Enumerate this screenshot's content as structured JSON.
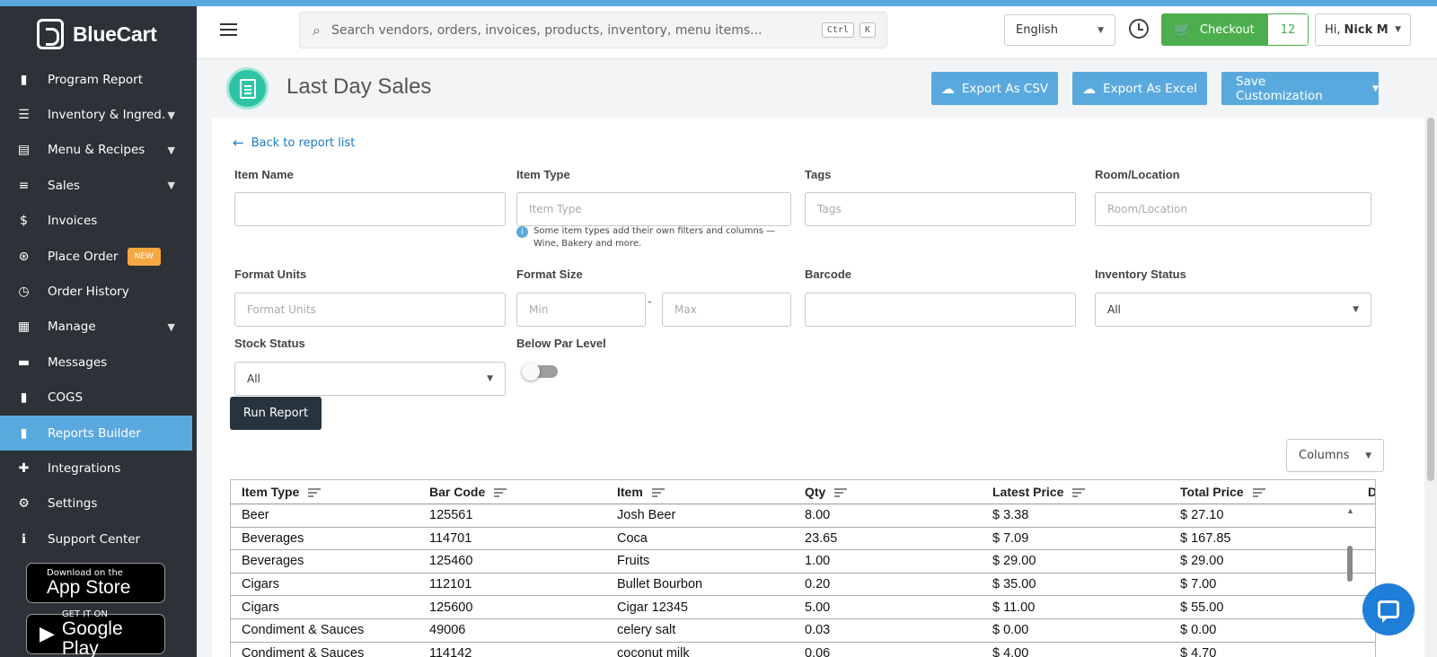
{
  "app": {
    "brand": "BlueCart",
    "accent": "#5aa9de",
    "sidebar_bg": "#2c3238"
  },
  "sidebar": {
    "items": [
      {
        "label": "Program Report",
        "icon": "bar-chart-icon",
        "glyph": "▮",
        "chevron": false
      },
      {
        "label": "Inventory & Ingred.",
        "icon": "list-icon",
        "glyph": "☰",
        "chevron": true
      },
      {
        "label": "Menu & Recipes",
        "icon": "book-icon",
        "glyph": "▤",
        "chevron": true
      },
      {
        "label": "Sales",
        "icon": "stack-icon",
        "glyph": "≡",
        "chevron": true
      },
      {
        "label": "Invoices",
        "icon": "dollar-icon",
        "glyph": "$",
        "chevron": false
      },
      {
        "label": "Place Order",
        "icon": "order-icon",
        "glyph": "⊛",
        "chevron": false,
        "badge": "NEW"
      },
      {
        "label": "Order History",
        "icon": "history-icon",
        "glyph": "◷",
        "chevron": false
      },
      {
        "label": "Manage",
        "icon": "manage-icon",
        "glyph": "▦",
        "chevron": true
      },
      {
        "label": "Messages",
        "icon": "message-icon",
        "glyph": "▬",
        "chevron": false
      },
      {
        "label": "COGS",
        "icon": "cogs-chart-icon",
        "glyph": "▮",
        "chevron": false
      },
      {
        "label": "Reports Builder",
        "icon": "reports-icon",
        "glyph": "▮",
        "chevron": false,
        "active": true
      },
      {
        "label": "Integrations",
        "icon": "puzzle-icon",
        "glyph": "✚",
        "chevron": false
      },
      {
        "label": "Settings",
        "icon": "gear-icon",
        "glyph": "⚙",
        "chevron": false
      },
      {
        "label": "Support Center",
        "icon": "info-icon",
        "glyph": "ℹ",
        "chevron": false
      }
    ],
    "app_store": {
      "small": "Download on the",
      "big": "App Store"
    },
    "google_play": {
      "small": "GET IT ON",
      "big": "Google Play"
    }
  },
  "header": {
    "search_placeholder": "Search vendors, orders, invoices, products, inventory, menu items...",
    "kbd_ctrl": "Ctrl",
    "kbd_k": "K",
    "language": "English",
    "checkout_label": "Checkout",
    "checkout_count": "12",
    "greeting": "Hi,",
    "user_name": "Nick M"
  },
  "page": {
    "title": "Last Day Sales",
    "export_csv": "Export As CSV",
    "export_excel": "Export As Excel",
    "save_customization": "Save Customization"
  },
  "filters": {
    "back_link": "Back to report list",
    "item_name": {
      "label": "Item Name",
      "value": ""
    },
    "item_type": {
      "label": "Item Type",
      "placeholder": "Item Type"
    },
    "tags": {
      "label": "Tags",
      "placeholder": "Tags"
    },
    "room": {
      "label": "Room/Location",
      "placeholder": "Room/Location"
    },
    "hint": "Some item types add their own filters and columns — Wine, Bakery and more.",
    "format_units": {
      "label": "Format Units",
      "placeholder": "Format Units"
    },
    "format_size": {
      "label": "Format Size",
      "min_placeholder": "Min",
      "max_placeholder": "Max",
      "separator": "-"
    },
    "barcode": {
      "label": "Barcode",
      "value": ""
    },
    "inventory_status": {
      "label": "Inventory Status",
      "value": "All"
    },
    "stock_status": {
      "label": "Stock Status",
      "value": "All"
    },
    "below_par": {
      "label": "Below Par Level",
      "on": false
    },
    "run_report": "Run Report",
    "columns": "Columns"
  },
  "table": {
    "headers": [
      "Item Type",
      "Bar Code",
      "Item",
      "Qty",
      "Latest Price",
      "Total Price",
      "Da"
    ],
    "rows": [
      [
        "Beer",
        "125561",
        "Josh Beer",
        "8.00",
        "$ 3.38",
        "$ 27.10"
      ],
      [
        "Beverages",
        "114701",
        "Coca",
        "23.65",
        "$ 7.09",
        "$ 167.85"
      ],
      [
        "Beverages",
        "125460",
        "Fruits",
        "1.00",
        "$ 29.00",
        "$ 29.00"
      ],
      [
        "Cigars",
        "112101",
        "Bullet Bourbon",
        "0.20",
        "$ 35.00",
        "$ 7.00"
      ],
      [
        "Cigars",
        "125600",
        "Cigar 12345",
        "5.00",
        "$ 11.00",
        "$ 55.00"
      ],
      [
        "Condiment & Sauces",
        "49006",
        "celery salt",
        "0.03",
        "$ 0.00",
        "$ 0.00"
      ],
      [
        "Condiment & Sauces",
        "114142",
        "coconut milk",
        "0.06",
        "$ 4.00",
        "$ 4.70"
      ]
    ]
  }
}
